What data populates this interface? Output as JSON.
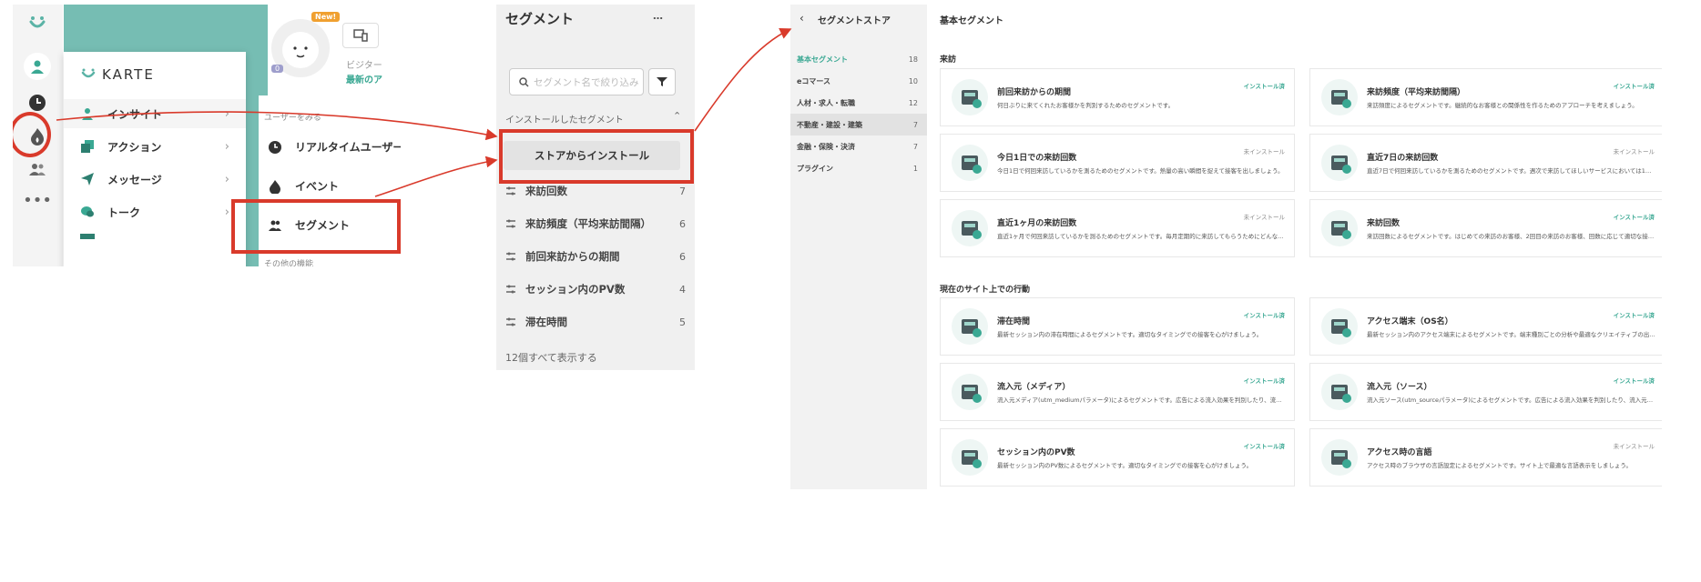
{
  "panel1": {
    "new_badge": "New!",
    "avatar_count": "0",
    "brand": "KARTE",
    "visitor_text": "ビジター",
    "latest_text": "最新のア",
    "menu": [
      {
        "label": "インサイト",
        "icon": "insight-person-icon"
      },
      {
        "label": "アクション",
        "icon": "action-icon"
      },
      {
        "label": "メッセージ",
        "icon": "paper-plane-icon"
      },
      {
        "label": "トーク",
        "icon": "chat-bubble-icon"
      }
    ],
    "submenu_header": "ユーザーをみる",
    "submenu": [
      {
        "label": "リアルタイムユーザー",
        "icon": "clock-icon"
      },
      {
        "label": "イベント",
        "icon": "flame-icon"
      },
      {
        "label": "セグメント",
        "icon": "users-icon"
      }
    ],
    "other_features": "その他の機能"
  },
  "panel2": {
    "title": "セグメント",
    "more": "…",
    "search_placeholder": "セグメント名で絞り込み",
    "section_label": "インストールしたセグメント",
    "install_button": "ストアからインストール",
    "segments": [
      {
        "name": "来訪回数",
        "count": "7"
      },
      {
        "name": "来訪頻度（平均来訪間隔）",
        "count": "6"
      },
      {
        "name": "前回来訪からの期間",
        "count": "6"
      },
      {
        "name": "セッション内のPV数",
        "count": "4"
      },
      {
        "name": "滞在時間",
        "count": "5"
      }
    ],
    "show_all": "12個すべて表示する"
  },
  "panel3": {
    "back": "‹",
    "store_title": "セグメントストア",
    "categories": [
      {
        "name": "基本セグメント",
        "count": "18",
        "active": true
      },
      {
        "name": "eコマース",
        "count": "10"
      },
      {
        "name": "人材・求人・転職",
        "count": "12"
      },
      {
        "name": "不動産・建設・建築",
        "count": "7",
        "selected": true
      },
      {
        "name": "金融・保険・決済",
        "count": "7"
      },
      {
        "name": "プラグイン",
        "count": "1"
      }
    ],
    "main_title": "基本セグメント",
    "section1": "来訪",
    "section2": "現在のサイト上での行動",
    "installed_label": "インストール済",
    "not_installed_label": "未インストール",
    "cards1": [
      {
        "title": "前回来訪からの期間",
        "desc": "何日ぶりに来てくれたお客様かを判別するためのセグメントです。",
        "status": "installed",
        "icon": "stopwatch-icon"
      },
      {
        "title": "来訪頻度（平均来訪間隔）",
        "desc": "来訪頻度によるセグメントです。継続的なお客様との関係性を作るためのアプローチを考えましょう。",
        "status": "installed",
        "icon": "calendar-icon"
      },
      {
        "title": "今日1日での来訪回数",
        "desc": "今日1日で何回来訪しているかを測るためのセグメントです。熱量の高い瞬間を捉えて接客を出しましょう。",
        "status": "not_installed",
        "icon": "dial-icon"
      },
      {
        "title": "直近7日の来訪回数",
        "desc": "直近7日で何回来訪しているかを測るためのセグメントです。週次で来訪してほしいサービスにおいては1週間の…",
        "status": "not_installed",
        "icon": "calendar-7d-icon"
      },
      {
        "title": "直近1ヶ月の来訪回数",
        "desc": "直近1ヶ月で何回来訪しているかを測るためのセグメントです。毎月定期的に来訪してもらうためにどんなア…",
        "status": "not_installed",
        "icon": "calendar-1m-icon"
      },
      {
        "title": "来訪回数",
        "desc": "来訪回数によるセグメントです。はじめての来訪のお客様、2回目の来訪のお客様、回数に応じて適切な接客…",
        "status": "installed",
        "icon": "counter-icon"
      }
    ],
    "cards2": [
      {
        "title": "滞在時間",
        "desc": "最新セッション内の滞在時間によるセグメントです。適切なタイミングでの接客を心がけましょう。",
        "status": "installed",
        "icon": "timer-display-icon"
      },
      {
        "title": "アクセス端末（OS名）",
        "desc": "最新セッション内のアクセス端末によるセグメントです。端末種別ごとの分析や最適なクリエイティブの出し…",
        "status": "installed",
        "icon": "smartphone-icon"
      },
      {
        "title": "流入元（メディア）",
        "desc": "流入元メディア(utm_mediumパラメータ)によるセグメントです。広告による流入効果を判別したり、流入元…",
        "status": "installed",
        "icon": "media-icon"
      },
      {
        "title": "流入元（ソース）",
        "desc": "流入元ソース(utm_sourceパラメータ)によるセグメントです。広告による流入効果を判別したり、流入元に応…",
        "status": "installed",
        "icon": "source-icon"
      },
      {
        "title": "セッション内のPV数",
        "desc": "最新セッション内のPV数によるセグメントです。適切なタイミングでの接客を心がけましょう。",
        "status": "installed",
        "icon": "pageview-icon"
      },
      {
        "title": "アクセス時の言語",
        "desc": "アクセス時のブラウザの言語設定によるセグメントです。サイト上で最適な言語表示をしましょう。",
        "status": "not_installed",
        "icon": "globe-doc-icon"
      }
    ]
  },
  "colors": {
    "accent": "#3aa893",
    "highlight": "#d93a2b",
    "teal_bg": "#76bdb3"
  }
}
